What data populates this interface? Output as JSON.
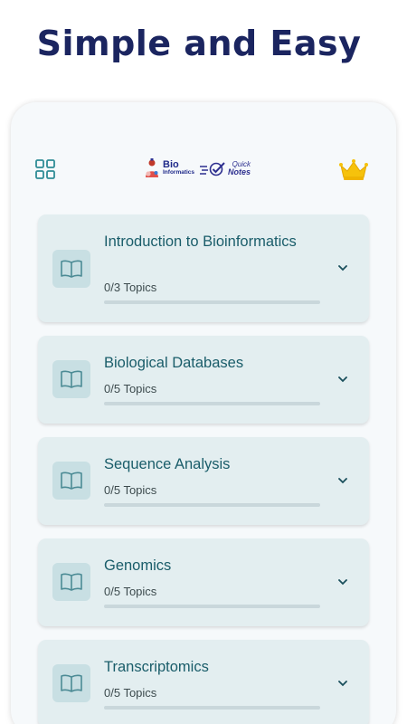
{
  "headline": "Simple and Easy",
  "app": {
    "logo": {
      "bio_line1": "Bio",
      "bio_line2": "Informatics",
      "qn_line1": "Quick",
      "qn_line2": "Notes"
    },
    "colors": {
      "accent": "#1a5d6a",
      "card_bg": "#e3eef0",
      "crown": "#f6c20c",
      "headline": "#1b2560"
    }
  },
  "chapters": [
    {
      "title": "Introduction to Bioinformatics",
      "topics": "0/3 Topics",
      "progress": 0
    },
    {
      "title": "Biological Databases",
      "topics": "0/5 Topics",
      "progress": 0
    },
    {
      "title": "Sequence Analysis",
      "topics": "0/5 Topics",
      "progress": 0
    },
    {
      "title": "Genomics",
      "topics": "0/5 Topics",
      "progress": 0
    },
    {
      "title": "Transcriptomics",
      "topics": "0/5 Topics",
      "progress": 0
    }
  ]
}
